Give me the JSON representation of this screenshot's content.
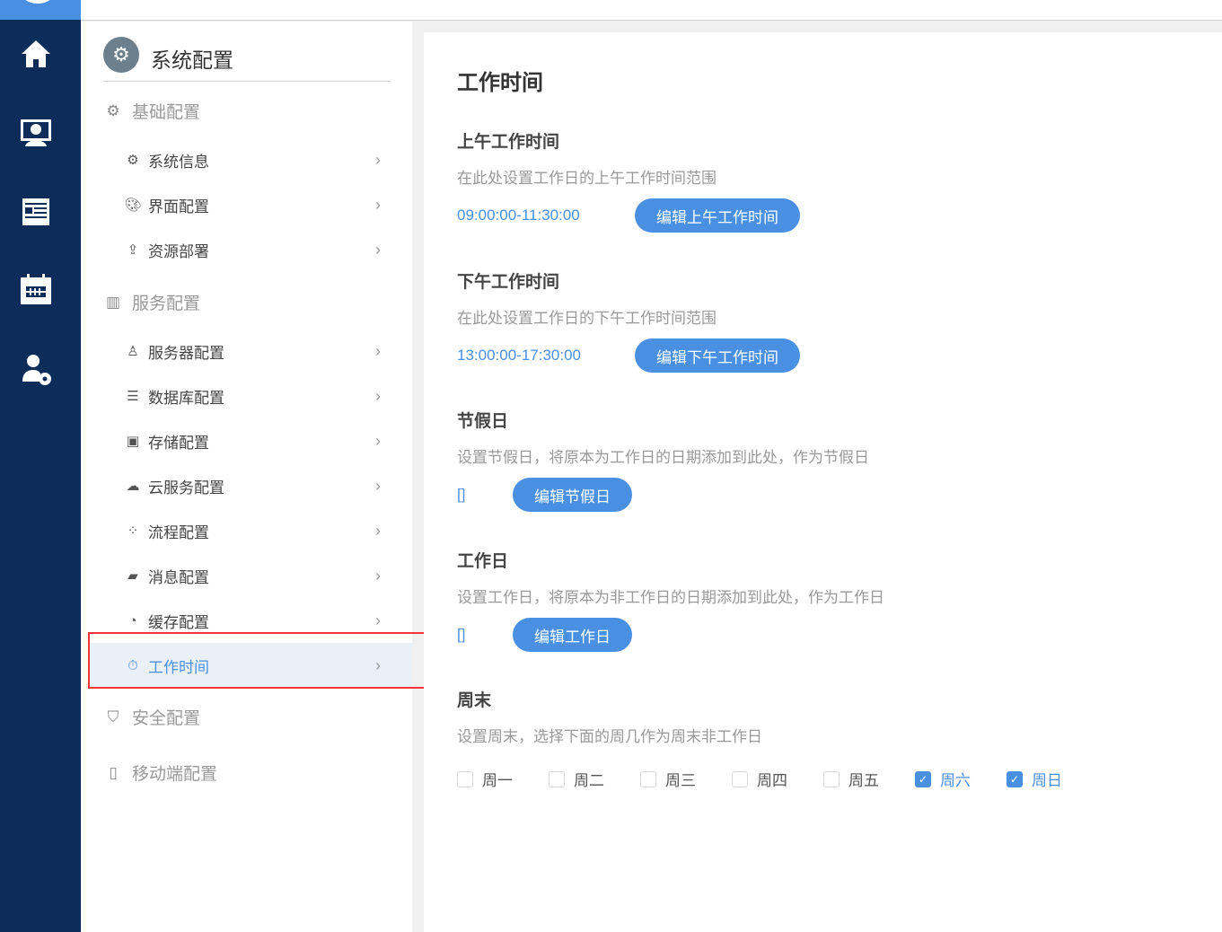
{
  "colors": {
    "rail": "#0c2c59",
    "accent": "#4a90e2",
    "highlight_border": "#f5333a"
  },
  "rail": {
    "items": [
      {
        "icon": "home-icon"
      },
      {
        "icon": "monitor-user-icon"
      },
      {
        "icon": "news-icon"
      },
      {
        "icon": "calendar-icon"
      },
      {
        "icon": "user-settings-icon"
      }
    ]
  },
  "sidebar": {
    "title": "系统配置",
    "groups": [
      {
        "label": "基础配置",
        "icon": "gear-icon",
        "items": [
          {
            "label": "系统信息",
            "icon": "gear-icon"
          },
          {
            "label": "界面配置",
            "icon": "palette-icon"
          },
          {
            "label": "资源部署",
            "icon": "upload-icon"
          }
        ]
      },
      {
        "label": "服务配置",
        "icon": "server-icon",
        "items": [
          {
            "label": "服务器配置",
            "icon": "server-user-icon"
          },
          {
            "label": "数据库配置",
            "icon": "database-icon"
          },
          {
            "label": "存储配置",
            "icon": "archive-icon"
          },
          {
            "label": "云服务配置",
            "icon": "cloud-icon"
          },
          {
            "label": "流程配置",
            "icon": "flow-icon"
          },
          {
            "label": "消息配置",
            "icon": "message-icon"
          },
          {
            "label": "缓存配置",
            "icon": "pie-icon"
          },
          {
            "label": "工作时间",
            "icon": "stopwatch-icon",
            "active": true
          }
        ]
      },
      {
        "label": "安全配置",
        "icon": "shield-icon"
      },
      {
        "label": "移动端配置",
        "icon": "mobile-icon"
      }
    ]
  },
  "main": {
    "title": "工作时间",
    "morning": {
      "heading": "上午工作时间",
      "desc": "在此处设置工作日的上午工作时间范围",
      "value": "09:00:00-11:30:00",
      "button": "编辑上午工作时间"
    },
    "afternoon": {
      "heading": "下午工作时间",
      "desc": "在此处设置工作日的下午工作时间范围",
      "value": "13:00:00-17:30:00",
      "button": "编辑下午工作时间"
    },
    "holiday": {
      "heading": "节假日",
      "desc": "设置节假日，将原本为工作日的日期添加到此处，作为节假日",
      "value": "[]",
      "button": "编辑节假日"
    },
    "workday": {
      "heading": "工作日",
      "desc": "设置工作日，将原本为非工作日的日期添加到此处，作为工作日",
      "value": "[]",
      "button": "编辑工作日"
    },
    "weekend": {
      "heading": "周末",
      "desc": "设置周末，选择下面的周几作为周末非工作日",
      "days": [
        {
          "label": "周一",
          "checked": false
        },
        {
          "label": "周二",
          "checked": false
        },
        {
          "label": "周三",
          "checked": false
        },
        {
          "label": "周四",
          "checked": false
        },
        {
          "label": "周五",
          "checked": false
        },
        {
          "label": "周六",
          "checked": true
        },
        {
          "label": "周日",
          "checked": true
        }
      ]
    }
  }
}
